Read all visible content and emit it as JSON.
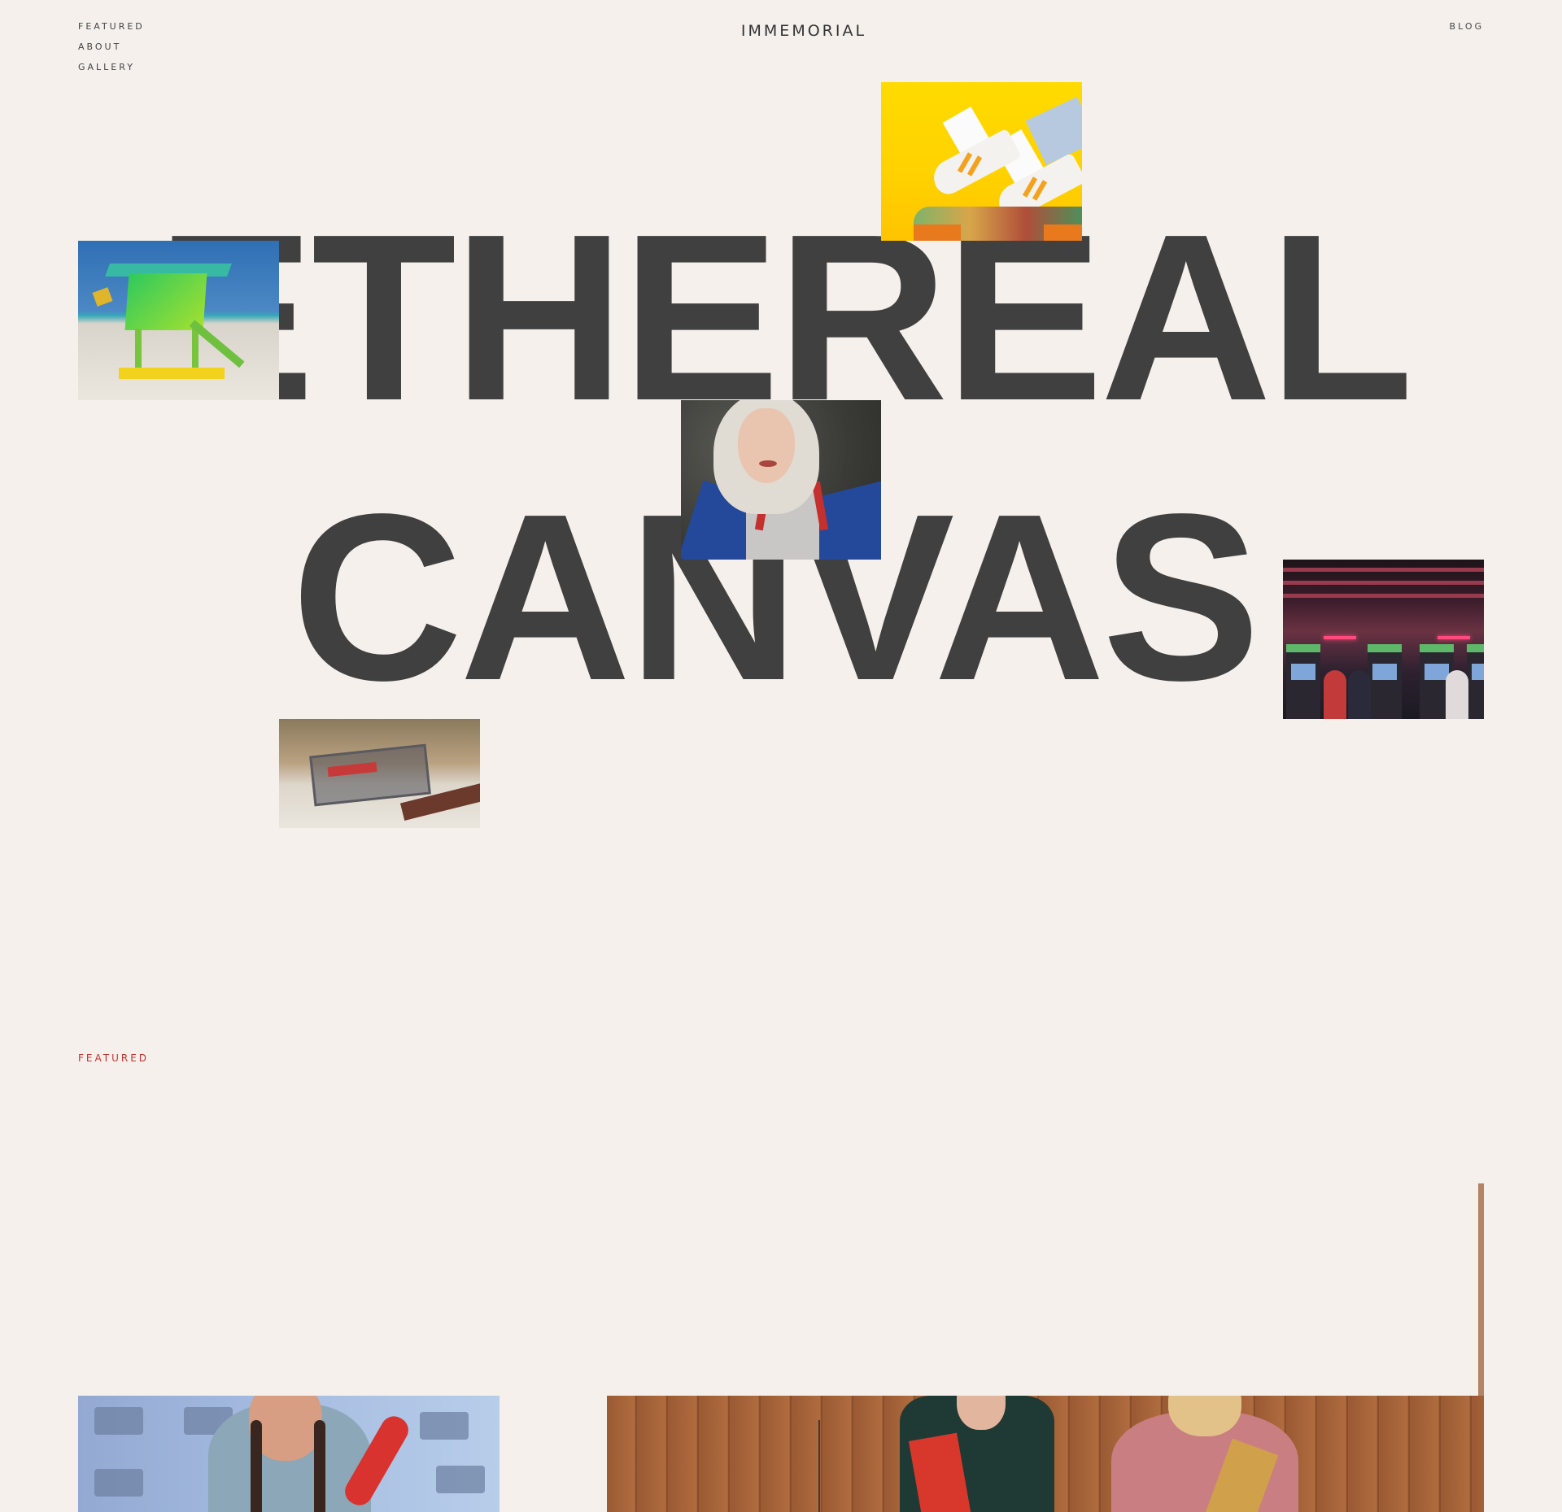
{
  "header": {
    "nav_left": [
      {
        "label": "featured"
      },
      {
        "label": "about"
      },
      {
        "label": "gallery"
      }
    ],
    "logo": "immemorial",
    "nav_right": {
      "label": "BLOG"
    }
  },
  "hero": {
    "line1": "ETHEREAL",
    "line2": "CANVAS",
    "photos": [
      {
        "name": "sneakers-photo",
        "description_icon": "sneakers-on-skateboard-image"
      },
      {
        "name": "beach-tower-photo",
        "description_icon": "lifeguard-tower-image"
      },
      {
        "name": "portrait-photo",
        "description_icon": "woman-portrait-image"
      },
      {
        "name": "arcade-photo",
        "description_icon": "arcade-image"
      },
      {
        "name": "cassette-photo",
        "description_icon": "cassette-image"
      }
    ]
  },
  "featured": {
    "label": "featured"
  },
  "colors": {
    "background": "#f5f0ec",
    "text": "#404040",
    "accent": "#c4332f",
    "scroll_indicator": "#b48466"
  }
}
